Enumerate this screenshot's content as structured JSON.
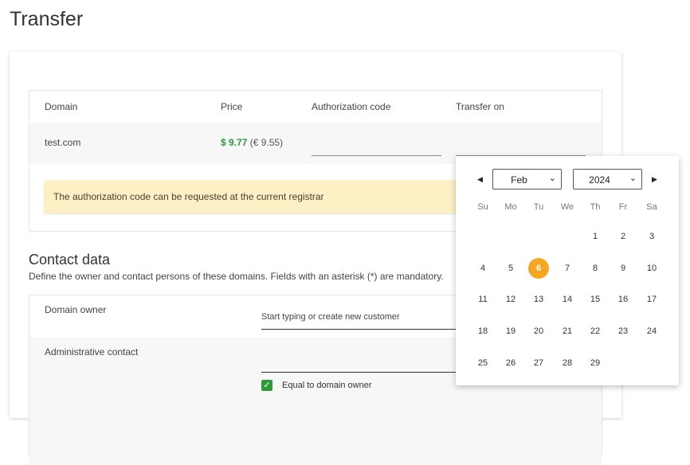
{
  "page": {
    "title": "Transfer"
  },
  "table": {
    "headers": [
      "Domain",
      "Price",
      "Authorization code",
      "Transfer on"
    ],
    "row": {
      "domain": "test.com",
      "price_usd": "$ 9.77",
      "price_eur": "(€ 9.55)"
    },
    "notice": "The authorization code can be requested at the current registrar"
  },
  "contact": {
    "title": "Contact data",
    "description": "Define the owner and contact persons of these domains. Fields with an asterisk (*) are mandatory.",
    "owner_label": "Domain owner",
    "owner_placeholder": "Start typing or create new customer",
    "admin_label": "Administrative contact",
    "equal_label": "Equal to domain owner",
    "equal_checked": true
  },
  "datepicker": {
    "month": "Feb",
    "year": "2024",
    "weekdays": [
      "Su",
      "Mo",
      "Tu",
      "We",
      "Th",
      "Fr",
      "Sa"
    ],
    "days": [
      "1",
      "2",
      "3",
      "4",
      "5",
      "6",
      "7",
      "8",
      "9",
      "10",
      "11",
      "12",
      "13",
      "14",
      "15",
      "16",
      "17",
      "18",
      "19",
      "20",
      "21",
      "22",
      "23",
      "24",
      "25",
      "26",
      "27",
      "28",
      "29"
    ],
    "selected": "6",
    "accent": "#f5a623"
  }
}
